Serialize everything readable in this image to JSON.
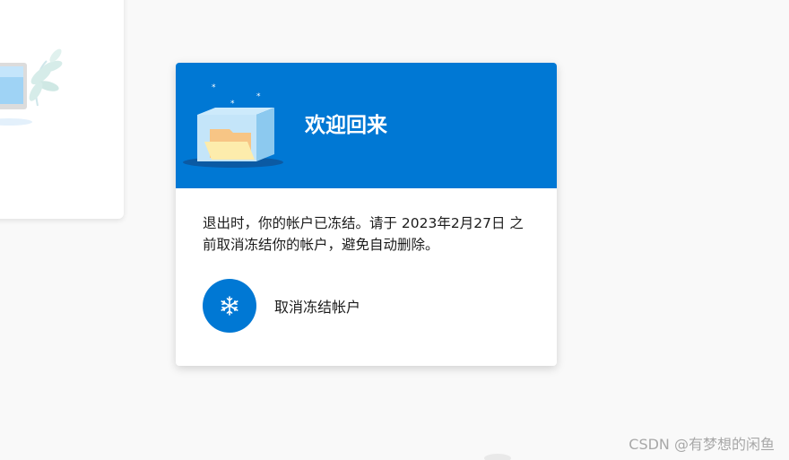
{
  "card": {
    "title": "欢迎回来",
    "message": "退出时，你的帐户已冻结。请于 2023年2月27日 之前取消冻结你的帐户，避免自动删除。",
    "action_label": "取消冻结帐户"
  },
  "icons": {
    "header_illustration": "frozen-folder-illustration",
    "action_icon": "snowflake-icon",
    "left_illustration": "laptop-plant-illustration"
  },
  "colors": {
    "brand": "#0078d4",
    "background": "#f9f9f9",
    "card": "#ffffff",
    "text": "#1b1b1b",
    "watermark": "#a8a8a8"
  },
  "watermark": "CSDN @有梦想的闲鱼"
}
